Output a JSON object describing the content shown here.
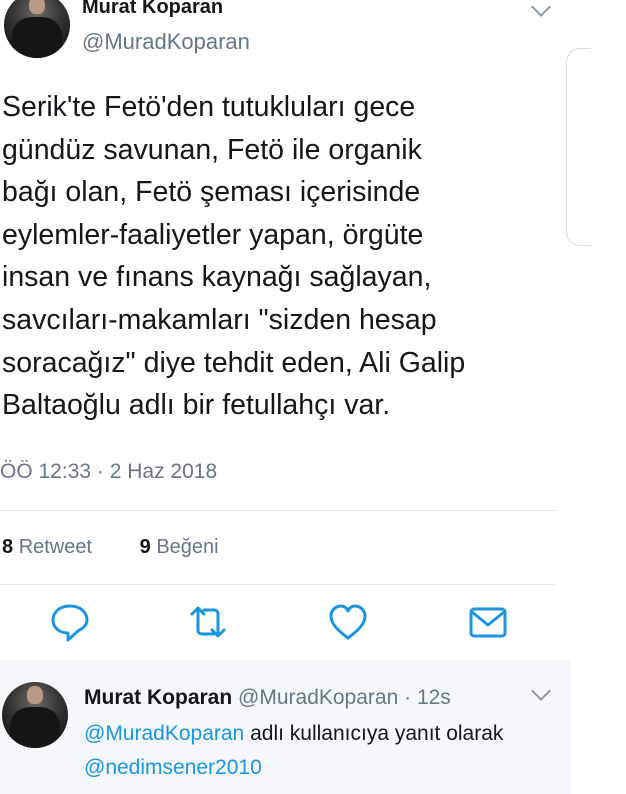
{
  "tweet": {
    "author_name": "Murat Koparan",
    "author_handle": "@MuradKoparan",
    "text": "Serik'te Fetö'den tutukluları gece\ngündüz savunan, Fetö ile organik\nbağı olan, Fetö şeması içerisinde\neylemler-faaliyetler yapan, örgüte\ninsan ve fınans kaynağı sağlayan,\nsavcıları-makamları \"sizden hesap\nsoracağız\" diye tehdit eden, Ali Galip\nBaltaoğlu adlı bir fetullahçı var.",
    "timestamp": "ÖÖ 12:33 · 2 Haz 2018",
    "retweet_count": "8",
    "retweet_label": "Retweet",
    "like_count": "9",
    "like_label": "Beğeni"
  },
  "actions": [
    "reply-icon",
    "retweet-icon",
    "like-icon",
    "message-icon"
  ],
  "reply": {
    "author_name": "Murat Koparan",
    "author_handle": "@MuradKoparan",
    "age": "· 12s",
    "reply_to_handle": "@MuradKoparan",
    "reply_to_text": "adlı kullanıcıya yanıt olarak",
    "mention": "@nedimsener2010"
  },
  "colors": {
    "text": "#14171a",
    "muted": "#657786",
    "link": "#1b95e0",
    "divider": "#e1e8ed",
    "icon": "#1b95e0",
    "reply_bg": "#f5f8fa"
  }
}
